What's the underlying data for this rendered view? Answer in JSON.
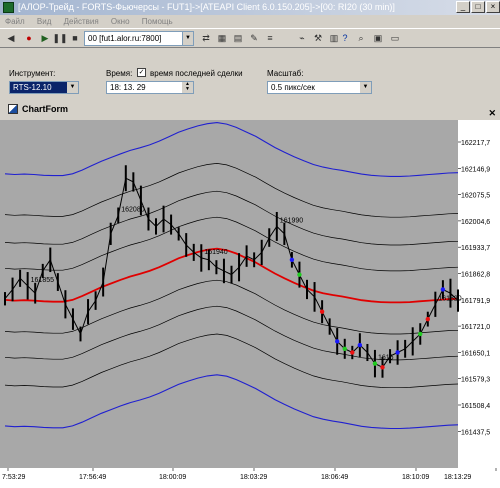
{
  "window": {
    "title": "[АЛОР-Трейд - FORTS-Фьючерсы - FUT1]->[ATEAPI Client 6.0.150.205]->[00: RI20 (30 min)]"
  },
  "menu": [
    "Файл",
    "Вид",
    "Действия",
    "Окно",
    "Помощь"
  ],
  "toolbar": {
    "connection_value": "00 [fut1.alor.ru:7800]",
    "icons": [
      "back-icon",
      "record-icon",
      "play-icon",
      "pause-icon",
      "stop-icon",
      "connect-icon",
      "table-icon",
      "table2-icon",
      "edit-icon",
      "list-icon",
      "chart-icon",
      "tool-icon",
      "grid-icon",
      "help-icon",
      "zoom-icon",
      "data-icon",
      "window-icon"
    ]
  },
  "params": {
    "instrument_label": "Инструмент:",
    "instrument_value": "RTS-12.10",
    "time_label": "Время:",
    "time_check_label": "время последней сделки",
    "time_checked": true,
    "time_value": "18: 13. 29",
    "scale_label": "Масштаб:",
    "scale_value": "0.5 пикс/сек"
  },
  "chartform": {
    "title": "ChartForm"
  },
  "chart_data": {
    "type": "line",
    "y_tick_labels": [
      "162217,7",
      "162146,9",
      "162075,5",
      "162004,6",
      "161933,7",
      "161862,8",
      "161791,9",
      "161721,0",
      "161650,1",
      "161579,3",
      "161508,4",
      "161437,5"
    ],
    "x_tick_labels": [
      "7:53:29",
      "17:56:49",
      "18:00:09",
      "18:03:29",
      "18:06:49",
      "18:10:09",
      "18:13:29"
    ],
    "price_annotations": [
      "161855",
      "162080",
      "161940",
      "161990",
      "161820",
      "1615"
    ],
    "colors": {
      "background": "#a8a8a8",
      "price": "#000000",
      "mean": "#e00000",
      "outer_band": "#2020d0",
      "inner_band": "#000000",
      "marker_blue": "#1a1aff",
      "marker_green": "#22cc22",
      "marker_red": "#ee1111"
    },
    "series": [
      {
        "name": "",
        "values": [
          161795,
          161820,
          161850,
          161830,
          161810,
          161870,
          161900,
          161840,
          161780,
          161740,
          161700,
          161760,
          161790,
          161840,
          161970,
          162020,
          162120,
          162110,
          162060,
          162010,
          161990,
          162010,
          161995,
          161970,
          161940,
          161920,
          161905,
          161900,
          161880,
          161870,
          161860,
          161880,
          161910,
          161900,
          161920,
          161960,
          161990,
          161970,
          161900,
          161860,
          161820,
          161800,
          161760,
          161720,
          161680,
          161660,
          161650,
          161670,
          161650,
          161620,
          161610,
          161640,
          161650,
          161660,
          161680,
          161700,
          161740,
          161780,
          161820,
          161810,
          161790
        ]
      },
      {
        "name": "",
        "values": [
          161792,
          161790,
          161791,
          161790,
          161788,
          161787,
          161787,
          161792,
          161802,
          161814,
          161826,
          161836,
          161846,
          161855,
          161862,
          161870,
          161880,
          161892,
          161904,
          161913,
          161921,
          161927,
          161930,
          161926,
          161917,
          161905,
          161893,
          161878,
          161863,
          161850,
          161838,
          161827,
          161817,
          161810,
          161805,
          161801,
          161796,
          161791,
          161788,
          161786,
          161785,
          161785,
          161786,
          161788,
          161790,
          161792,
          161794,
          161795
        ]
      }
    ]
  }
}
